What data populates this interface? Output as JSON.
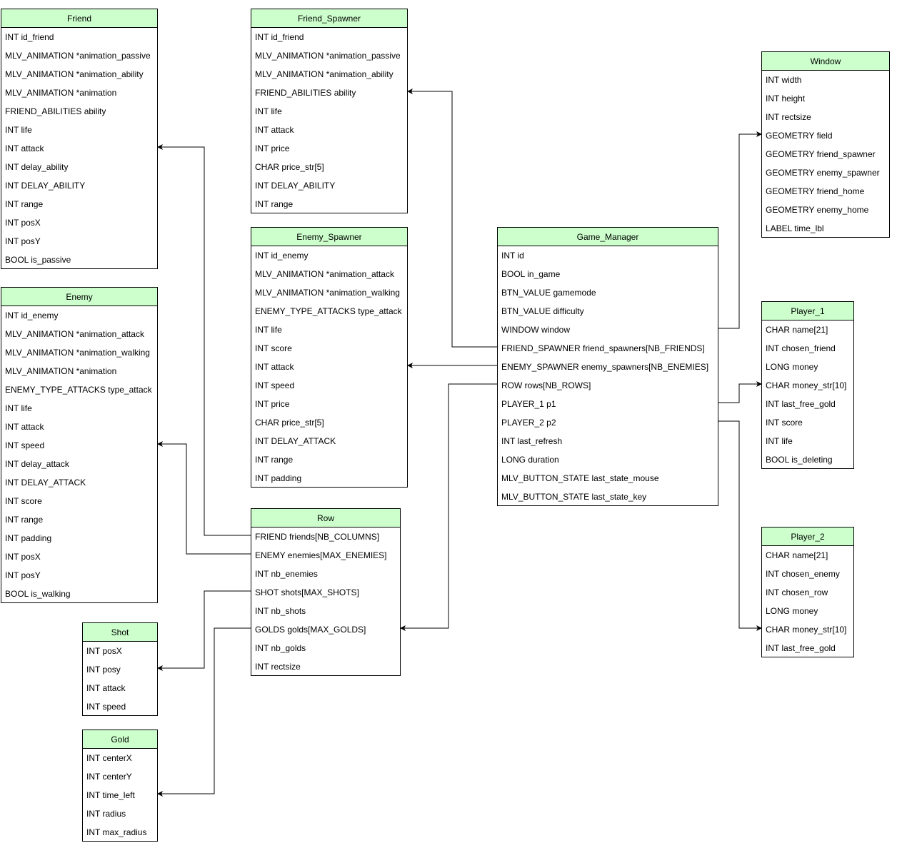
{
  "colors": {
    "header": "#ccffcc",
    "border": "#000000",
    "edge": "#000000"
  },
  "entities": [
    {
      "name": "Friend",
      "fields": [
        "INT id_friend",
        "MLV_ANIMATION *animation_passive",
        "MLV_ANIMATION *animation_ability",
        "MLV_ANIMATION *animation",
        "FRIEND_ABILITIES ability",
        "INT life",
        "INT attack",
        "INT delay_ability",
        "INT DELAY_ABILITY",
        "INT range",
        "INT posX",
        "INT posY",
        "BOOL is_passive"
      ]
    },
    {
      "name": "Enemy",
      "fields": [
        "INT id_enemy",
        "MLV_ANIMATION *animation_attack",
        "MLV_ANIMATION *animation_walking",
        "MLV_ANIMATION *animation",
        "ENEMY_TYPE_ATTACKS type_attack",
        "INT life",
        "INT attack",
        "INT speed",
        "INT delay_attack",
        "INT DELAY_ATTACK",
        "INT score",
        "INT range",
        "INT padding",
        "INT posX",
        "INT posY",
        "BOOL is_walking"
      ]
    },
    {
      "name": "Shot",
      "fields": [
        "INT posX",
        "INT posy",
        "INT attack",
        "INT speed"
      ]
    },
    {
      "name": "Gold",
      "fields": [
        "INT centerX",
        "INT centerY",
        "INT time_left",
        "INT radius",
        "INT max_radius"
      ]
    },
    {
      "name": "Friend_Spawner",
      "fields": [
        "INT id_friend",
        "MLV_ANIMATION *animation_passive",
        "MLV_ANIMATION *animation_ability",
        "FRIEND_ABILITIES ability",
        "INT life",
        "INT attack",
        "INT price",
        "CHAR price_str[5]",
        "INT DELAY_ABILITY",
        "INT range"
      ]
    },
    {
      "name": "Enemy_Spawner",
      "fields": [
        "INT id_enemy",
        "MLV_ANIMATION *animation_attack",
        "MLV_ANIMATION *animation_walking",
        "ENEMY_TYPE_ATTACKS type_attack",
        "INT life",
        "INT score",
        "INT attack",
        "INT speed",
        "INT price",
        "CHAR price_str[5]",
        "INT DELAY_ATTACK",
        "INT range",
        "INT padding"
      ]
    },
    {
      "name": "Row",
      "fields": [
        "FRIEND friends[NB_COLUMNS]",
        "ENEMY enemies[MAX_ENEMIES]",
        "INT nb_enemies",
        "SHOT shots[MAX_SHOTS]",
        "INT nb_shots",
        "GOLDS golds[MAX_GOLDS]",
        "INT nb_golds",
        "INT rectsize"
      ]
    },
    {
      "name": "Game_Manager",
      "fields": [
        "INT id",
        "BOOL in_game",
        "BTN_VALUE gamemode",
        "BTN_VALUE difficulty",
        "WINDOW window",
        "FRIEND_SPAWNER friend_spawners[NB_FRIENDS]",
        "ENEMY_SPAWNER enemy_spawners[NB_ENEMIES]",
        "ROW rows[NB_ROWS]",
        "PLAYER_1 p1",
        "PLAYER_2 p2",
        "INT last_refresh",
        "LONG duration",
        "MLV_BUTTON_STATE last_state_mouse",
        "MLV_BUTTON_STATE last_state_key"
      ]
    },
    {
      "name": "Window",
      "fields": [
        "INT width",
        "INT height",
        "INT rectsize",
        "GEOMETRY field",
        "GEOMETRY friend_spawner",
        "GEOMETRY enemy_spawner",
        "GEOMETRY friend_home",
        "GEOMETRY enemy_home",
        "LABEL time_lbl"
      ]
    },
    {
      "name": "Player_1",
      "fields": [
        "CHAR name[21]",
        "INT chosen_friend",
        "LONG money",
        "CHAR money_str[10]",
        "INT last_free_gold",
        "INT score",
        "INT life",
        "BOOL is_deleting"
      ]
    },
    {
      "name": "Player_2",
      "fields": [
        "CHAR name[21]",
        "INT chosen_enemy",
        "INT chosen_row",
        "LONG money",
        "CHAR money_str[10]",
        "INT last_free_gold"
      ]
    }
  ],
  "relations": [
    {
      "from": "Row.friends",
      "to": "Friend.attack"
    },
    {
      "from": "Row.enemies",
      "to": "Enemy.speed"
    },
    {
      "from": "Row.shots",
      "to": "Shot.posy"
    },
    {
      "from": "Row.golds",
      "to": "Gold.time_left"
    },
    {
      "from": "Game_Manager.friend_spawners",
      "to": "Friend_Spawner.ability"
    },
    {
      "from": "Game_Manager.enemy_spawners",
      "to": "Enemy_Spawner.attack"
    },
    {
      "from": "Game_Manager.rows",
      "to": "Row.golds"
    },
    {
      "from": "Game_Manager.window",
      "to": "Window.field"
    },
    {
      "from": "Game_Manager.p1",
      "to": "Player_1.money_str"
    },
    {
      "from": "Game_Manager.p2",
      "to": "Player_2.money_str"
    }
  ]
}
